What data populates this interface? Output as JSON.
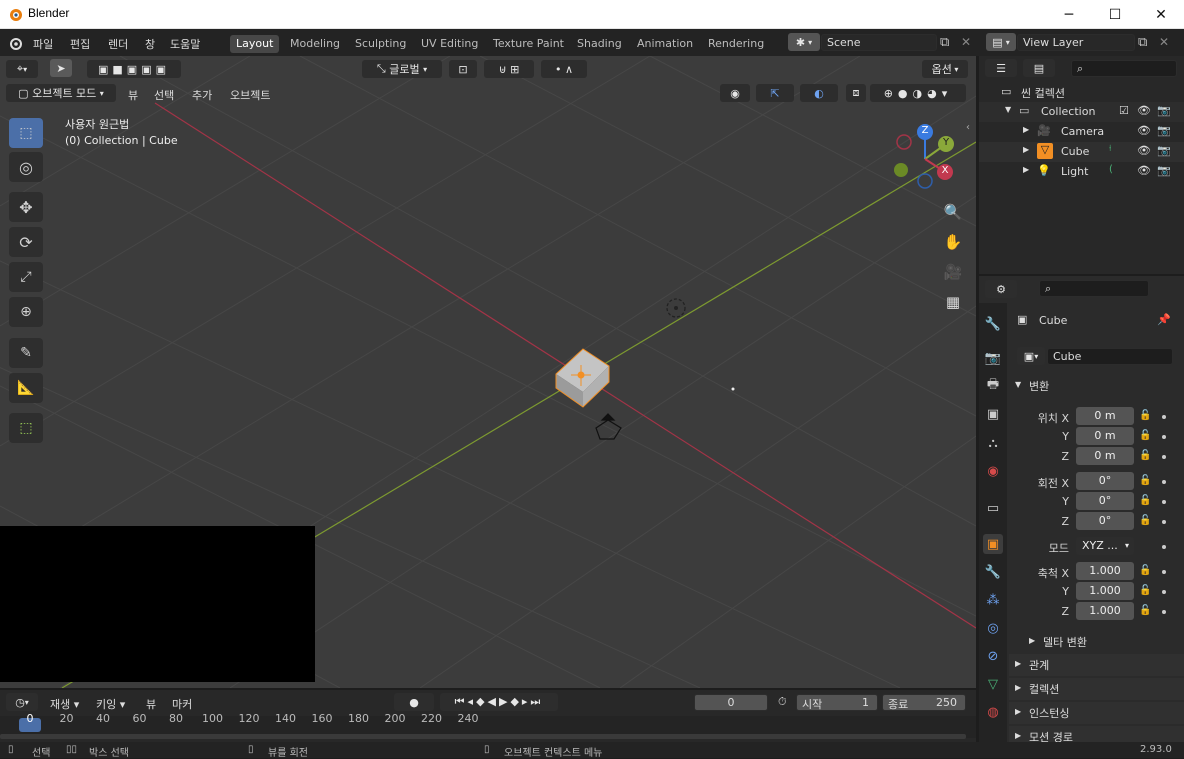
{
  "window": {
    "title": "Blender",
    "minimize": "─",
    "maximize": "☐",
    "close": "✕"
  },
  "menu": [
    "파일",
    "편집",
    "렌더",
    "창",
    "도움말"
  ],
  "workspaces": [
    "Layout",
    "Modeling",
    "Sculpting",
    "UV Editing",
    "Texture Paint",
    "Shading",
    "Animation",
    "Rendering"
  ],
  "scene": {
    "name": "Scene",
    "view_layer": "View Layer"
  },
  "viewport_header": {
    "transform_orientation": "글로벌",
    "options": "옵션",
    "mode": "오브젝트 모드",
    "view": "뷰",
    "select": "선택",
    "add": "추가",
    "object": "오브젝트"
  },
  "viewport": {
    "view_name": "사용자 원근법",
    "info": "(0) Collection | Cube",
    "gizmo": {
      "x": "X",
      "y": "Y",
      "z": "Z"
    }
  },
  "outliner": {
    "scene_collection": "씬 컬렉션",
    "items": [
      {
        "label": "Collection",
        "icon": "collection-icon"
      },
      {
        "label": "Camera",
        "icon": "camera-icon"
      },
      {
        "label": "Cube",
        "icon": "mesh-icon"
      },
      {
        "label": "Light",
        "icon": "light-icon"
      }
    ]
  },
  "properties": {
    "object_name": "Cube",
    "object_field": "Cube",
    "transform_section": "변환",
    "location_label": "위치",
    "rotation_label": "회전",
    "mode_label": "모드",
    "scale_label": "축척",
    "axis_x": "X",
    "axis_y": "Y",
    "axis_z": "Z",
    "location": {
      "x": "0 m",
      "y": "0 m",
      "z": "0 m"
    },
    "rotation": {
      "x": "0°",
      "y": "0°",
      "z": "0°"
    },
    "mode": "XYZ ...",
    "scale": {
      "x": "1.000",
      "y": "1.000",
      "z": "1.000"
    },
    "delta": "델타 변환",
    "relations": "관계",
    "collections": "컬렉션",
    "instancing": "인스턴싱",
    "motion_paths": "모션 경로"
  },
  "timeline": {
    "playback": "재생",
    "keying": "키잉",
    "view": "뷰",
    "marker": "마커",
    "current_frame": "0",
    "start_label": "시작",
    "start": "1",
    "end_label": "종료",
    "end": "250",
    "ruler": [
      "0",
      "20",
      "40",
      "60",
      "80",
      "100",
      "120",
      "140",
      "160",
      "180",
      "200",
      "220",
      "240"
    ]
  },
  "status": {
    "select": "선택",
    "box_select": "박스 선택",
    "rotate_view": "뷰를 회전",
    "context_menu": "오브젝트 컨텍스트 메뉴",
    "version": "2.93.0"
  },
  "colors": {
    "x_axis": "#c2394f",
    "y_axis": "#8aa83a",
    "z_axis": "#3a7be0",
    "selected": "#f28f24",
    "active_tool": "#4b6fa8"
  }
}
